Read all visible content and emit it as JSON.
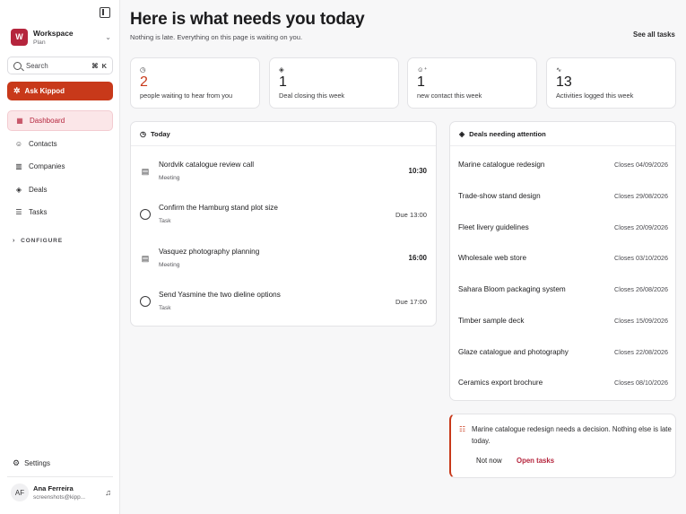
{
  "sidebar": {
    "workspace": {
      "initial": "W",
      "name": "Workspace",
      "plan": "Plan"
    },
    "search": {
      "label": "Search",
      "shortcut_cmd": "⌘",
      "shortcut_key": "K"
    },
    "ask_button": "Ask Kippod",
    "nav": [
      {
        "label": "Dashboard",
        "icon": "grid-icon",
        "active": true
      },
      {
        "label": "Contacts",
        "icon": "users-icon"
      },
      {
        "label": "Companies",
        "icon": "building-icon"
      },
      {
        "label": "Deals",
        "icon": "handshake-icon"
      },
      {
        "label": "Tasks",
        "icon": "checklist-icon"
      }
    ],
    "configure": "CONFIGURE",
    "settings": "Settings",
    "user": {
      "initials": "AF",
      "name": "Ana Ferreira",
      "email": "screenshots@kipp..."
    }
  },
  "header": {
    "title": "Here is what needs you today",
    "subtitle": "Nothing is late. Everything on this page is waiting on you.",
    "see_all": "See all tasks"
  },
  "stats": [
    {
      "value": "2",
      "label": "people waiting to hear from you",
      "icon": "clock-icon",
      "accent": true
    },
    {
      "value": "1",
      "label": "Deal closing this week",
      "icon": "handshake-icon"
    },
    {
      "value": "1",
      "label": "new contact this week",
      "icon": "user-plus-icon"
    },
    {
      "value": "13",
      "label": "Activities logged this week",
      "icon": "activity-icon"
    }
  ],
  "today": {
    "title": "Today",
    "items": [
      {
        "title": "Nordvik catalogue review call",
        "type": "Meeting",
        "time": "10:30",
        "kind": "meeting"
      },
      {
        "title": "Confirm the Hamburg stand plot size",
        "type": "Task",
        "time": "Due 13:00",
        "kind": "task"
      },
      {
        "title": "Vasquez photography planning",
        "type": "Meeting",
        "time": "16:00",
        "kind": "meeting"
      },
      {
        "title": "Send Yasmine the two dieline options",
        "type": "Task",
        "time": "Due 17:00",
        "kind": "task"
      }
    ]
  },
  "deals": {
    "title": "Deals needing attention",
    "items": [
      {
        "name": "Marine catalogue redesign",
        "closes": "Closes 04/09/2026"
      },
      {
        "name": "Trade-show stand design",
        "closes": "Closes 29/08/2026"
      },
      {
        "name": "Fleet livery guidelines",
        "closes": "Closes 20/09/2026"
      },
      {
        "name": "Wholesale web store",
        "closes": "Closes 03/10/2026"
      },
      {
        "name": "Sahara Bloom packaging system",
        "closes": "Closes 26/08/2026"
      },
      {
        "name": "Timber sample deck",
        "closes": "Closes 15/09/2026"
      },
      {
        "name": "Glaze catalogue and photography",
        "closes": "Closes 22/08/2026"
      },
      {
        "name": "Ceramics export brochure",
        "closes": "Closes 08/10/2026"
      }
    ]
  },
  "alert": {
    "text": "Marine catalogue redesign needs a decision. Nothing else is late today.",
    "not_now": "Not now",
    "open_tasks": "Open tasks"
  },
  "colors": {
    "accent": "#c8391a",
    "brand": "#b5253d"
  }
}
